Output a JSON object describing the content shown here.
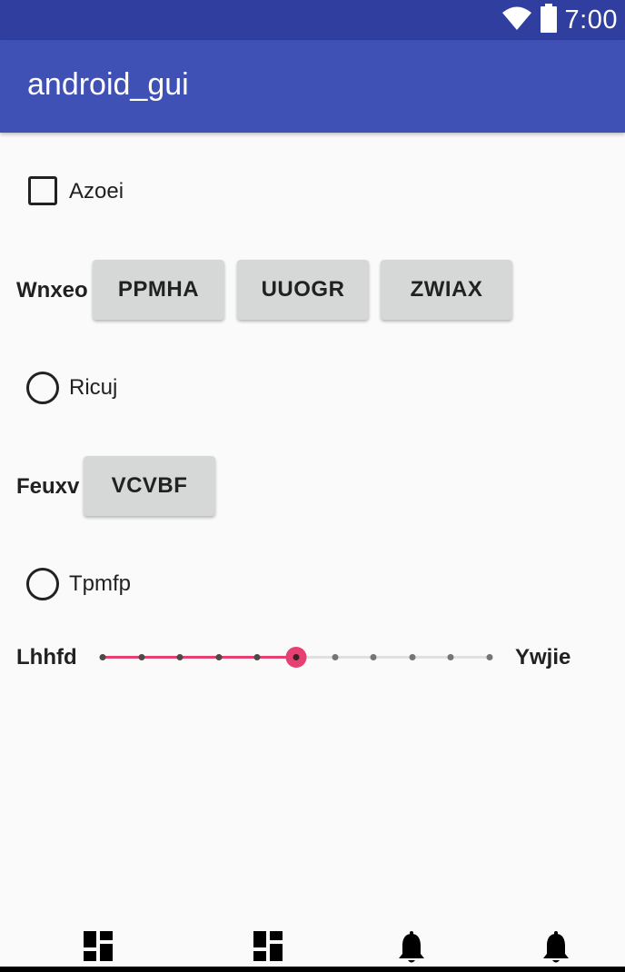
{
  "status_bar": {
    "time": "7:00",
    "icons": [
      "wifi-icon",
      "battery-icon"
    ]
  },
  "app_bar": {
    "title": "android_gui"
  },
  "checkbox": {
    "label": "Azoei",
    "checked": false
  },
  "button_group_1": {
    "label": "Wnxeo",
    "buttons": [
      "PPMHA",
      "UUOGR",
      "ZWIAX"
    ]
  },
  "radio_1": {
    "label": "Ricuj",
    "selected": false
  },
  "button_group_2": {
    "label": "Feuxv",
    "buttons": [
      "VCVBF"
    ]
  },
  "radio_2": {
    "label": "Tpmfp",
    "selected": false
  },
  "seekbar": {
    "min_label": "Lhhfd",
    "max_label": "Ywjie",
    "max": 10,
    "value": 5,
    "accent_color": "#e64073"
  },
  "bottom_nav": {
    "icons": [
      "dashboard-icon",
      "dashboard-icon",
      "bell-icon",
      "bell-icon"
    ]
  },
  "colors": {
    "status_bar": "#303f9f",
    "app_bar": "#3f51b5",
    "button": "#d6d7d7"
  }
}
